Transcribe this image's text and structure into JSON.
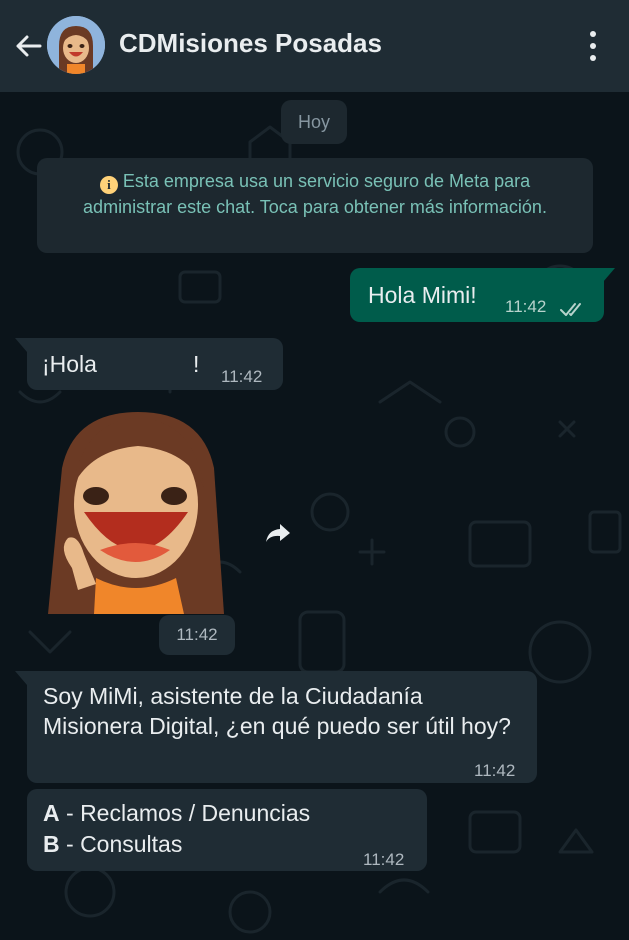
{
  "header": {
    "title": "CDMisiones Posadas",
    "background": "#1f2c34"
  },
  "chat": {
    "date_chip": "Hoy",
    "notice": {
      "text": "Esta empresa usa un servicio seguro de Meta para administrar este chat. Toca para obtener más información.",
      "icon": "info-icon"
    },
    "messages": [
      {
        "direction": "out",
        "text": "Hola Mimi!",
        "time": "11:42",
        "status_icon": "double-check-icon"
      },
      {
        "direction": "in",
        "text": "¡Hola",
        "suffix": "!",
        "time": "11:42"
      },
      {
        "direction": "in",
        "type": "sticker",
        "time": "11:42",
        "icon": "girl-waving-sticker"
      },
      {
        "direction": "in",
        "text": "Soy MiMi, asistente de la Ciudadanía Misionera Digital, ¿en qué puedo ser útil hoy?",
        "time": "11:42"
      },
      {
        "direction": "in",
        "options": [
          {
            "key": "A",
            "label": " - Reclamos / Denuncias"
          },
          {
            "key": "B",
            "label": " - Consultas"
          }
        ],
        "time": "11:42"
      }
    ]
  },
  "colors": {
    "outgoing_bubble": "#005c4b",
    "incoming_bubble": "#1f2c34",
    "chat_background": "#0b141a"
  }
}
